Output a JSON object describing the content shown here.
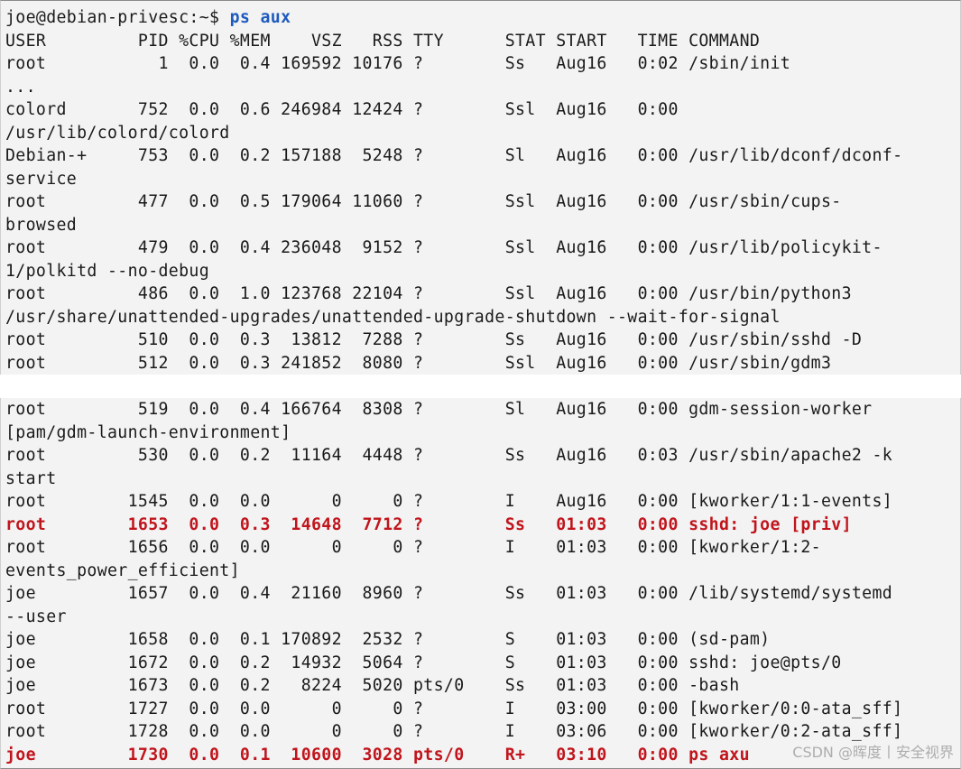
{
  "terminal": {
    "prompt": "joe@debian-privesc:~$ ",
    "command": "ps aux",
    "top_lines": [
      {
        "text": "USER         PID %CPU %MEM    VSZ   RSS TTY      STAT START   TIME COMMAND",
        "highlight": false
      },
      {
        "text": "root           1  0.0  0.4 169592 10176 ?        Ss   Aug16   0:02 /sbin/init",
        "highlight": false
      },
      {
        "text": "...",
        "highlight": false
      },
      {
        "text": "colord       752  0.0  0.6 246984 12424 ?        Ssl  Aug16   0:00",
        "highlight": false
      },
      {
        "text": "/usr/lib/colord/colord",
        "highlight": false
      },
      {
        "text": "Debian-+     753  0.0  0.2 157188  5248 ?        Sl   Aug16   0:00 /usr/lib/dconf/dconf-",
        "highlight": false
      },
      {
        "text": "service",
        "highlight": false
      },
      {
        "text": "root         477  0.0  0.5 179064 11060 ?        Ssl  Aug16   0:00 /usr/sbin/cups-",
        "highlight": false
      },
      {
        "text": "browsed",
        "highlight": false
      },
      {
        "text": "root         479  0.0  0.4 236048  9152 ?        Ssl  Aug16   0:00 /usr/lib/policykit-",
        "highlight": false
      },
      {
        "text": "1/polkitd --no-debug",
        "highlight": false
      },
      {
        "text": "root         486  0.0  1.0 123768 22104 ?        Ssl  Aug16   0:00 /usr/bin/python3",
        "highlight": false
      },
      {
        "text": "/usr/share/unattended-upgrades/unattended-upgrade-shutdown --wait-for-signal",
        "highlight": false
      },
      {
        "text": "root         510  0.0  0.3  13812  7288 ?        Ss   Aug16   0:00 /usr/sbin/sshd -D",
        "highlight": false
      },
      {
        "text": "root         512  0.0  0.3 241852  8080 ?        Ssl  Aug16   0:00 /usr/sbin/gdm3",
        "highlight": false
      }
    ],
    "bottom_lines": [
      {
        "text": "root         519  0.0  0.4 166764  8308 ?        Sl   Aug16   0:00 gdm-session-worker",
        "highlight": false
      },
      {
        "text": "[pam/gdm-launch-environment]",
        "highlight": false
      },
      {
        "text": "root         530  0.0  0.2  11164  4448 ?        Ss   Aug16   0:03 /usr/sbin/apache2 -k",
        "highlight": false
      },
      {
        "text": "start",
        "highlight": false
      },
      {
        "text": "root        1545  0.0  0.0      0     0 ?        I    Aug16   0:00 [kworker/1:1-events]",
        "highlight": false
      },
      {
        "text": "root        1653  0.0  0.3  14648  7712 ?        Ss   01:03   0:00 sshd: joe [priv]",
        "highlight": true
      },
      {
        "text": "root        1656  0.0  0.0      0     0 ?        I    01:03   0:00 [kworker/1:2-",
        "highlight": false
      },
      {
        "text": "events_power_efficient]",
        "highlight": false
      },
      {
        "text": "joe         1657  0.0  0.4  21160  8960 ?        Ss   01:03   0:00 /lib/systemd/systemd",
        "highlight": false
      },
      {
        "text": "--user",
        "highlight": false
      },
      {
        "text": "joe         1658  0.0  0.1 170892  2532 ?        S    01:03   0:00 (sd-pam)",
        "highlight": false
      },
      {
        "text": "joe         1672  0.0  0.2  14932  5064 ?        S    01:03   0:00 sshd: joe@pts/0",
        "highlight": false
      },
      {
        "text": "joe         1673  0.0  0.2   8224  5020 pts/0    Ss   01:03   0:00 -bash",
        "highlight": false
      },
      {
        "text": "root        1727  0.0  0.0      0     0 ?        I    03:00   0:00 [kworker/0:0-ata_sff]",
        "highlight": false
      },
      {
        "text": "root        1728  0.0  0.0      0     0 ?        I    03:06   0:00 [kworker/0:2-ata_sff]",
        "highlight": false
      },
      {
        "text": "joe         1730  0.0  0.1  10600  3028 pts/0    R+   03:10   0:00 ps axu",
        "highlight": true
      }
    ]
  },
  "watermark": "CSDN @晖度丨安全视界",
  "colors": {
    "highlight": "#c0151c",
    "command": "#1e5bbf",
    "background": "#f3f3f3"
  }
}
